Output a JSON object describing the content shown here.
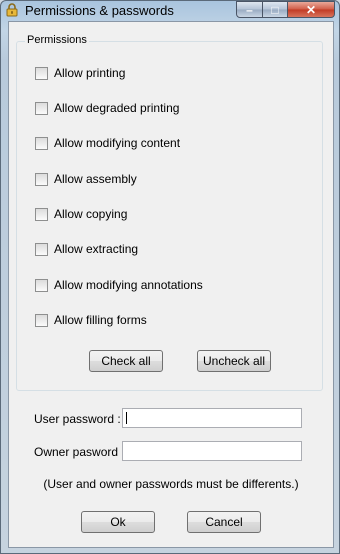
{
  "window": {
    "title": "Permissions & passwords",
    "icon": "lock-icon"
  },
  "titlebar_buttons": {
    "minimize": "–",
    "maximize": "□",
    "close": "✕"
  },
  "permissions": {
    "group_label": "Permissions",
    "items": [
      {
        "label": "Allow printing",
        "checked": false
      },
      {
        "label": "Allow degraded printing",
        "checked": false
      },
      {
        "label": "Allow modifying content",
        "checked": false
      },
      {
        "label": "Allow assembly",
        "checked": false
      },
      {
        "label": "Allow copying",
        "checked": false
      },
      {
        "label": "Allow extracting",
        "checked": false
      },
      {
        "label": "Allow modifying annotations",
        "checked": false
      },
      {
        "label": "Allow filling forms",
        "checked": false
      }
    ],
    "check_all_label": "Check all",
    "uncheck_all_label": "Uncheck all"
  },
  "passwords": {
    "user_label": "User password :",
    "user_value": "",
    "owner_label": "Owner pasword :",
    "owner_value": "",
    "note": "(User and owner passwords must be differents.)"
  },
  "footer": {
    "ok_label": "Ok",
    "cancel_label": "Cancel"
  },
  "colors": {
    "titlebar": "#a9c4de",
    "close_button": "#c13a24",
    "dialog_bg": "#f0f0f0"
  }
}
